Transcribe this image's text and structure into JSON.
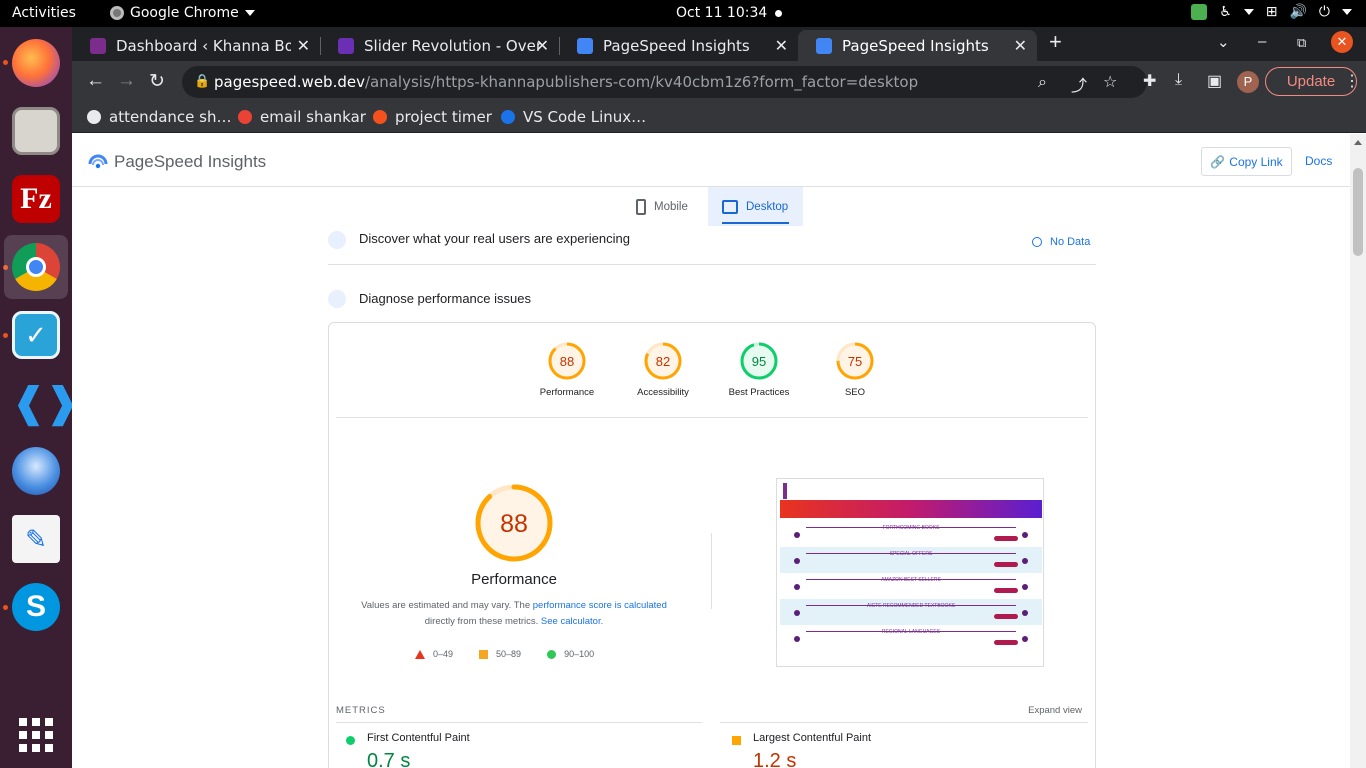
{
  "os": {
    "activities": "Activities",
    "app_name": "Google Chrome",
    "clock": "Oct 11  10:34"
  },
  "tabs": [
    {
      "title": "Dashboard ‹ Khanna Book",
      "favicon_color": "#7b2c8c"
    },
    {
      "title": "Slider Revolution - Overvie",
      "favicon_color": "#6a2fb3"
    },
    {
      "title": "PageSpeed Insights",
      "favicon_color": "#4285f4"
    },
    {
      "title": "PageSpeed Insights",
      "favicon_color": "#4285f4"
    }
  ],
  "address_bar": {
    "host": "pagespeed.web.dev",
    "path": "/analysis/https-khannapublishers-com/kv40cbm1z6?form_factor=desktop"
  },
  "update_button": "Update",
  "profile_initial": "P",
  "bookmarks": [
    {
      "label": "attendance sh…",
      "icon_color": "#e8eaed"
    },
    {
      "label": "email shankar",
      "icon_color": "#ea4335"
    },
    {
      "label": "project timer",
      "icon_color": "#f4511e"
    },
    {
      "label": "VS Code Linux…",
      "icon_color": "#1a73e8"
    }
  ],
  "psi": {
    "title": "PageSpeed Insights",
    "copy_link": "Copy Link",
    "docs": "Docs",
    "device_tabs": {
      "mobile": "Mobile",
      "desktop": "Desktop"
    },
    "discover": "Discover what your real users are experiencing",
    "no_data": "No Data",
    "diagnose": "Diagnose performance issues",
    "scores": [
      {
        "label": "Performance",
        "value": 88,
        "color": "#c33300"
      },
      {
        "label": "Accessibility",
        "value": 82,
        "color": "#c33300"
      },
      {
        "label": "Best Practices",
        "value": 95,
        "color": "#018642"
      },
      {
        "label": "SEO",
        "value": 75,
        "color": "#c33300"
      }
    ],
    "main_score": {
      "value": "88",
      "label": "Performance"
    },
    "note_prefix": "Values are estimated and may vary. The ",
    "note_link1": "performance score is calculated",
    "note_mid": "directly from these metrics. ",
    "note_link2": "See calculator.",
    "legend": [
      "0–49",
      "50–89",
      "90–100"
    ],
    "metrics_title": "METRICS",
    "expand_view": "Expand view",
    "metrics": [
      {
        "name": "First Contentful Paint",
        "value": "0.7 s",
        "color": "#018642"
      },
      {
        "name": "Largest Contentful Paint",
        "value": "1.2 s",
        "color": "#c33300"
      }
    ],
    "screenshot_sections": [
      "FORTHCOMING BOOKS",
      "SPECIAL OFFERS",
      "AMAZON BEST SELLERS",
      "AICTE RECOMMENDED TEXTBOOKS",
      "REGIONAL LANGUAGES"
    ]
  },
  "colors": {
    "pass": "#0cce6b",
    "average": "#ffa400",
    "fail": "#ff4e42",
    "accent": "#1a73e8"
  }
}
